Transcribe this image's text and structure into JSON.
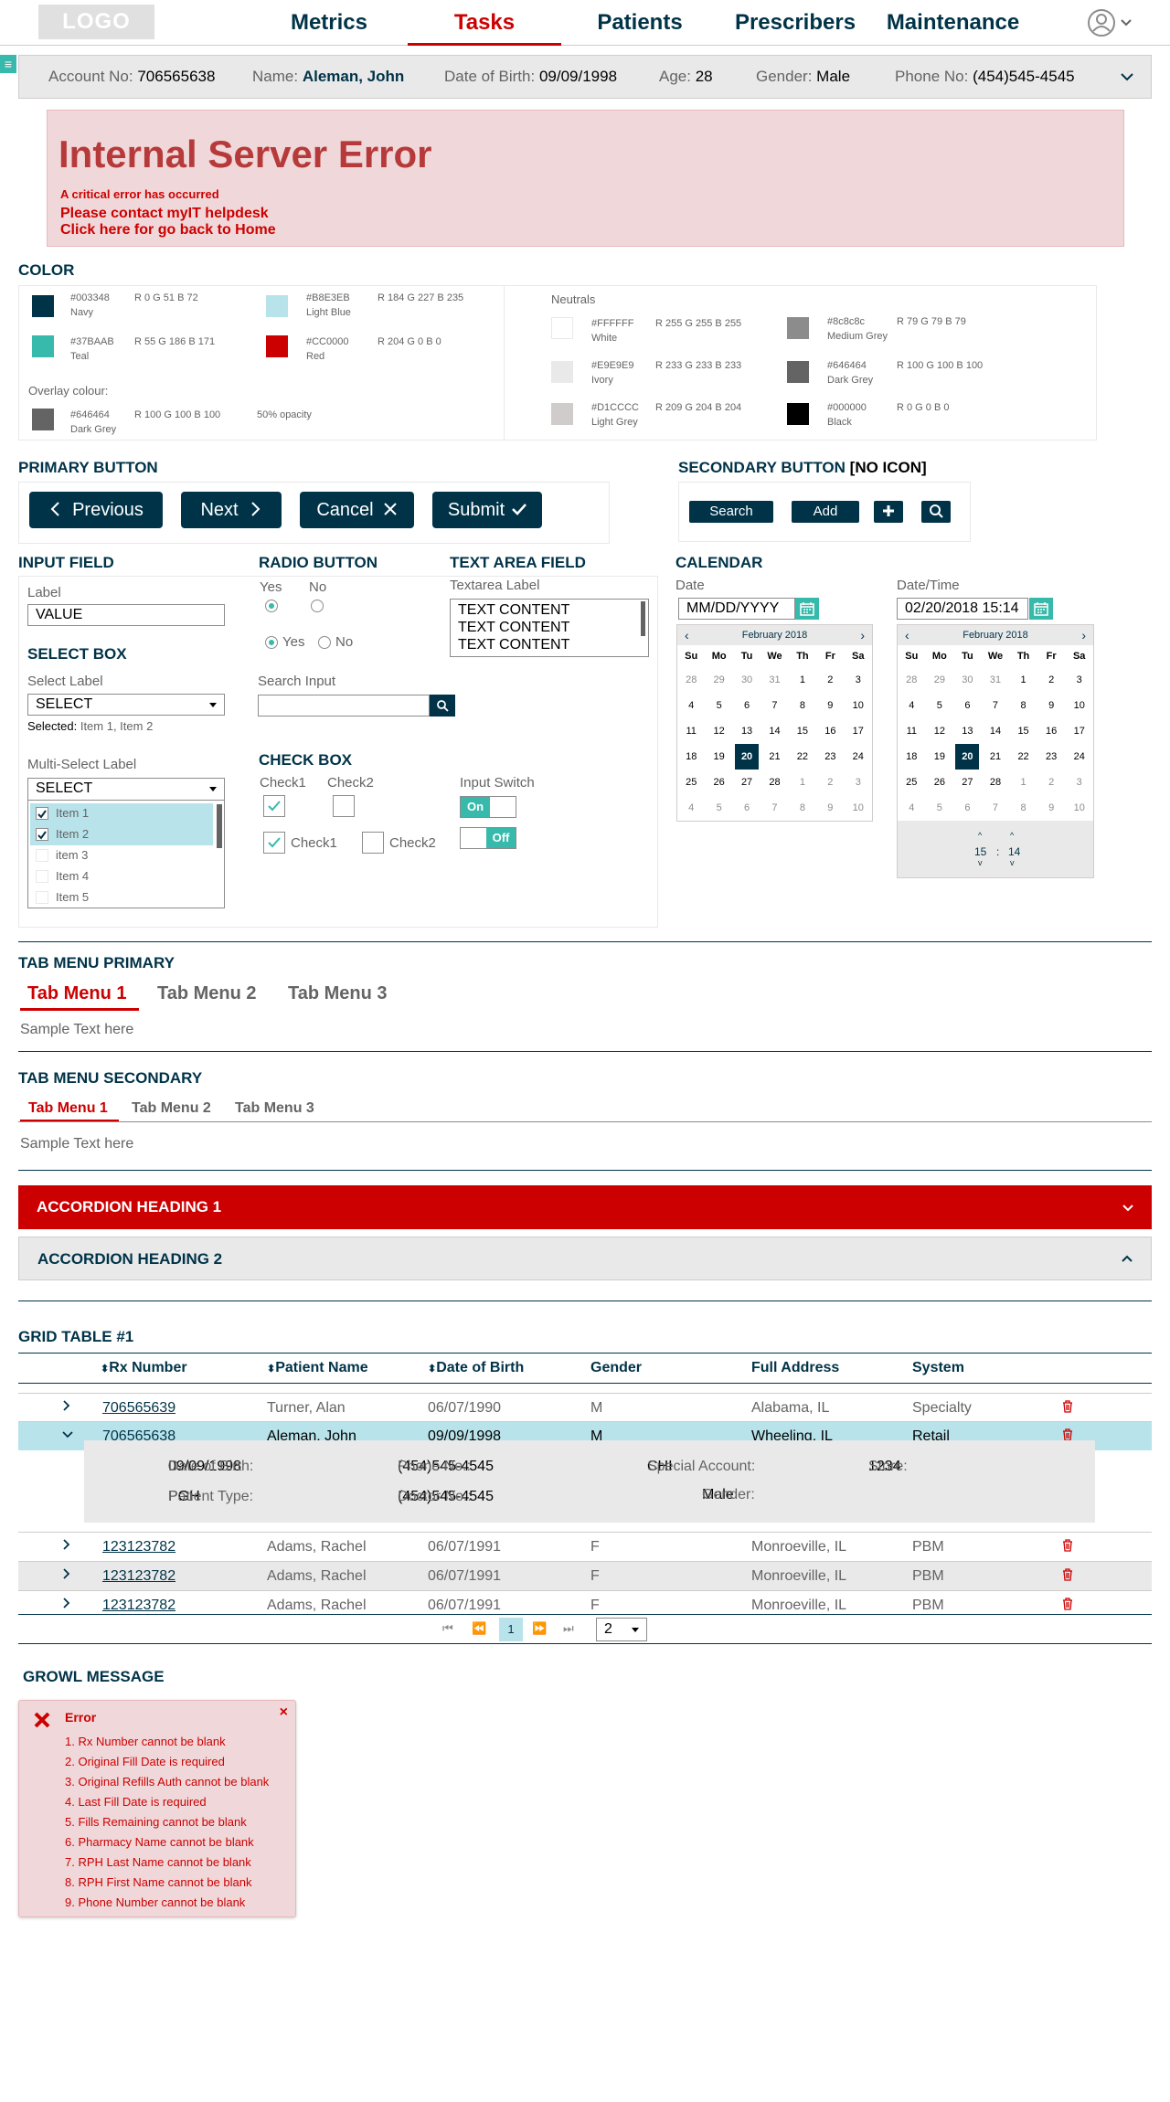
{
  "header": {
    "logo": "LOGO",
    "nav": [
      "Metrics",
      "Tasks",
      "Patients",
      "Prescribers",
      "Maintenance"
    ],
    "active_nav": "Tasks"
  },
  "patient": {
    "account_label": "Account No:",
    "account": "706565638",
    "name_label": "Name:",
    "name": "Aleman, John",
    "dob_label": "Date of Birth:",
    "dob": "09/09/1998",
    "age_label": "Age:",
    "age": "28",
    "gender_label": "Gender:",
    "gender": "Male",
    "phone_label": "Phone No:",
    "phone": "(454)545-4545"
  },
  "error": {
    "title": "Internal Server Error",
    "subtitle": "A critical error has occurred",
    "line1": "Please contact myIT helpdesk",
    "line2": "Click here for go back to Home"
  },
  "colors": {
    "heading": "COLOR",
    "swatches": [
      {
        "hex": "#003348",
        "rgb": "R 0 G 51 B 72",
        "name": "Navy"
      },
      {
        "hex": "#B8E3EB",
        "rgb": "R 184 G 227 B 235",
        "name": "Light Blue"
      },
      {
        "hex": "#37BAAB",
        "rgb": "R 55 G 186 B 171",
        "name": "Teal"
      },
      {
        "hex": "#CC0000",
        "rgb": "R 204 G 0 B 0",
        "name": "Red"
      }
    ],
    "overlay_label": "Overlay colour:",
    "overlay": {
      "hex": "#646464",
      "rgb": "R 100 G 100 B 100",
      "name": "Dark Grey",
      "note": "50% opacity"
    },
    "neutrals_label": "Neutrals",
    "neutrals": [
      {
        "hex": "#FFFFFF",
        "rgb": "R 255 G 255 B 255",
        "name": "White"
      },
      {
        "hex": "#8c8c8c",
        "rgb": "R 79 G 79 B 79",
        "name": "Medium Grey"
      },
      {
        "hex": "#E9E9E9",
        "rgb": "R 233 G 233 B 233",
        "name": "Ivory"
      },
      {
        "hex": "#646464",
        "rgb": "R 100 G 100 B 100",
        "name": "Dark Grey"
      },
      {
        "hex": "#D1CCCC",
        "rgb": "R 209 G 204 B 204",
        "name": "Light Grey"
      },
      {
        "hex": "#000000",
        "rgb": "R 0 G 0 B 0",
        "name": "Black"
      }
    ]
  },
  "primary_button": {
    "heading": "PRIMARY BUTTON",
    "previous": "Previous",
    "next": "Next",
    "cancel": "Cancel",
    "submit": "Submit"
  },
  "secondary_button": {
    "heading": "SECONDARY BUTTON",
    "heading_suffix": "[NO ICON]",
    "search": "Search",
    "add": "Add"
  },
  "input_field": {
    "heading": "INPUT FIELD",
    "label": "Label",
    "value": "VALUE"
  },
  "select_box": {
    "heading": "SELECT BOX",
    "label": "Select Label",
    "value": "SELECT",
    "selected_label": "Selected:",
    "selected_value": "Item 1, Item 2",
    "multi_label": "Multi-Select Label",
    "multi_value": "SELECT",
    "items": [
      {
        "label": "Item 1",
        "checked": true
      },
      {
        "label": "Item 2",
        "checked": true
      },
      {
        "label": "item 3",
        "checked": false
      },
      {
        "label": "Item 4",
        "checked": false
      },
      {
        "label": "Item 5",
        "checked": false
      }
    ]
  },
  "radio": {
    "heading": "RADIO BUTTON",
    "yes": "Yes",
    "no": "No"
  },
  "search_input": {
    "label": "Search Input"
  },
  "checkbox": {
    "heading": "CHECK BOX",
    "check1": "Check1",
    "check2": "Check2",
    "switch_label": "Input Switch",
    "on": "On",
    "off": "Off"
  },
  "textarea": {
    "heading": "TEXT AREA FIELD",
    "label": "Textarea Label",
    "lines": [
      "TEXT CONTENT",
      "TEXT CONTENT",
      "TEXT CONTENT"
    ]
  },
  "calendar": {
    "heading": "CALENDAR",
    "date_label": "Date",
    "date_placeholder": "MM/DD/YYYY",
    "datetime_label": "Date/Time",
    "datetime_value": "02/20/2018 15:14",
    "month": "February 2018",
    "dow": [
      "Su",
      "Mo",
      "Tu",
      "We",
      "Th",
      "Fr",
      "Sa"
    ],
    "days": [
      "28",
      "29",
      "30",
      "31",
      "1",
      "2",
      "3",
      "4",
      "5",
      "6",
      "7",
      "8",
      "9",
      "10",
      "11",
      "12",
      "13",
      "14",
      "15",
      "16",
      "17",
      "18",
      "19",
      "20",
      "21",
      "22",
      "23",
      "24",
      "25",
      "26",
      "27",
      "28",
      "1",
      "2",
      "3",
      "4",
      "5",
      "6",
      "7",
      "8",
      "9",
      "10"
    ],
    "selected": "20",
    "hour": "15",
    "minute": "14"
  },
  "tabs_primary": {
    "heading": "TAB MENU PRIMARY",
    "tabs": [
      "Tab Menu 1",
      "Tab Menu 2",
      "Tab Menu 3"
    ],
    "content": "Sample Text here"
  },
  "tabs_secondary": {
    "heading": "TAB MENU SECONDARY",
    "tabs": [
      "Tab Menu 1",
      "Tab Menu 2",
      "Tab Menu 3"
    ],
    "content": "Sample Text here"
  },
  "accordion": {
    "h1": "ACCORDION HEADING 1",
    "h2": "ACCORDION HEADING 2"
  },
  "grid": {
    "heading": "GRID TABLE #1",
    "columns": [
      "Rx Number",
      "Patient Name",
      "Date of Birth",
      "Gender",
      "Full Address",
      "System"
    ],
    "rows": [
      [
        "706565639",
        "Turner, Alan",
        "06/07/1990",
        "M",
        "Alabama, IL",
        "Specialty"
      ],
      [
        "706565638",
        "Aleman, John",
        "09/09/1998",
        "M",
        "Wheeling, IL",
        "Retail"
      ],
      [
        "123123782",
        "Adams, Rachel",
        "06/07/1991",
        "F",
        "Monroeville, IL",
        "PBM"
      ],
      [
        "123123782",
        "Adams, Rachel",
        "06/07/1991",
        "F",
        "Monroeville, IL",
        "PBM"
      ],
      [
        "123123782",
        "Adams, Rachel",
        "06/07/1991",
        "F",
        "Monroeville, IL",
        "PBM"
      ]
    ],
    "detail": {
      "dob_label": "Date of Birth:",
      "dob": "09/09/1998",
      "phone_label": "Phone No.:",
      "phone": "(454)545-4545",
      "special_label": "Special Account:",
      "special": "CHI",
      "store_label": "Store:",
      "store": "1234",
      "type_label": "Patient Type:",
      "type": "PGH",
      "doctor_label": "Doctor No.:",
      "doctor": "(454)545-4545",
      "gender_label": "Gender:",
      "gender": "Male"
    },
    "page": "1",
    "page_size": "2"
  },
  "growl": {
    "heading": "GROWL MESSAGE",
    "title": "Error",
    "messages": [
      "1. Rx Number cannot be blank",
      "2. Original Fill Date is required",
      "3. Original Refills Auth cannot be blank",
      "4. Last Fill Date is required",
      "5. Fills Remaining cannot be blank",
      "6. Pharmacy Name cannot be blank",
      "7. RPH Last Name cannot be blank",
      "8. RPH First Name cannot be blank",
      "9. Phone Number cannot be blank"
    ]
  }
}
